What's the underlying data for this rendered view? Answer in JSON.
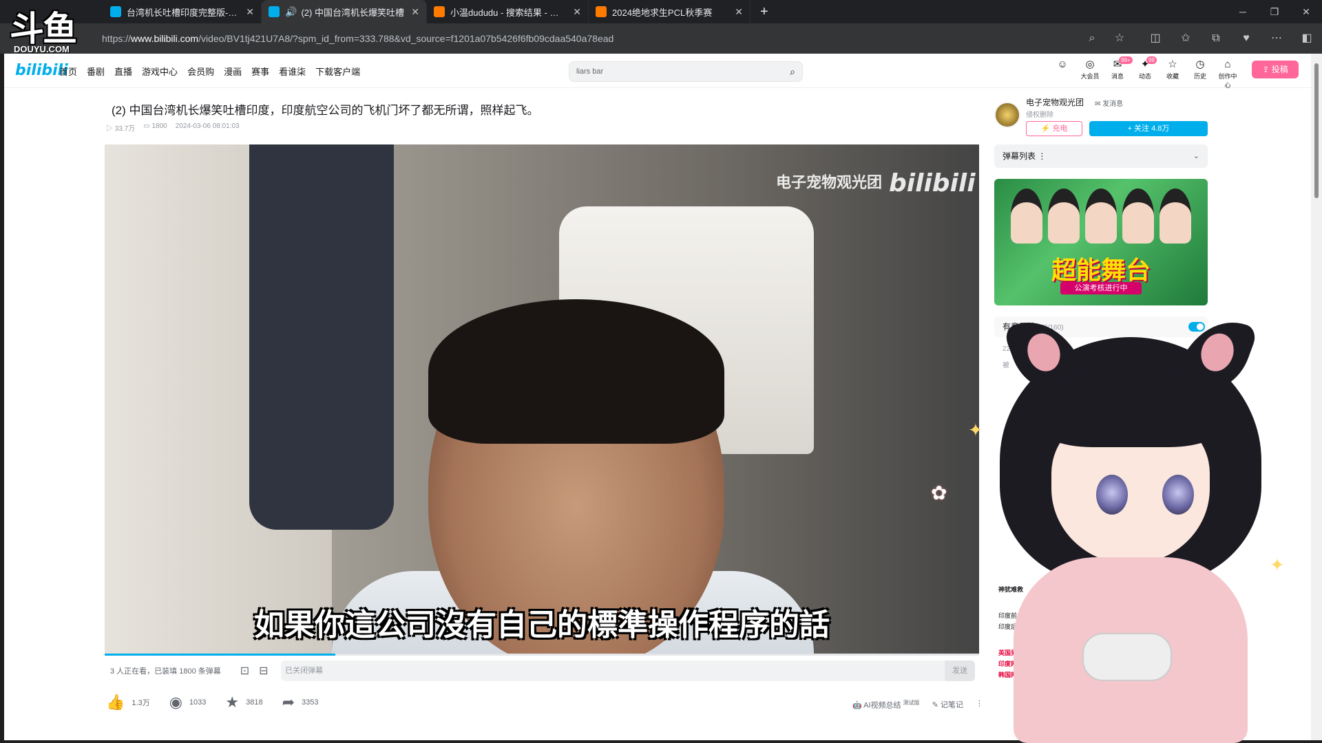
{
  "browser": {
    "tabs": [
      {
        "title": "台湾机长吐槽印度完整版-哔哩哔",
        "color": "#00aeec"
      },
      {
        "title": "(2) 中国台湾机长爆笑吐槽",
        "color": "#00aeec",
        "active": true
      },
      {
        "title": "小温dududu - 搜索结果 - 斗鱼直",
        "color": "#ff7a00"
      },
      {
        "title": "2024绝地求生PCL秋季赛",
        "color": "#ff7a00"
      }
    ],
    "new_tab": "+",
    "url_prefix": "https://",
    "url_host": "www.bilibili.com",
    "url_path": "/video/BV1tj421U7A8/?spm_id_from=333.788&vd_source=f1201a07b5426f6fb09cdaa540a78ead"
  },
  "overlay": {
    "logo": "斗鱼",
    "sub": "DOUYU.COM"
  },
  "header": {
    "logo": "bilibili",
    "nav": [
      "首页",
      "番剧",
      "直播",
      "游戏中心",
      "会员购",
      "漫画",
      "赛事",
      "看谁柒",
      "下载客户端"
    ],
    "search_value": "liars bar",
    "icons": [
      {
        "label": "",
        "badge": ""
      },
      {
        "label": "大会员",
        "badge": ""
      },
      {
        "label": "消息",
        "badge": "99+"
      },
      {
        "label": "动态",
        "badge": "99"
      },
      {
        "label": "收藏",
        "badge": ""
      },
      {
        "label": "历史",
        "badge": ""
      },
      {
        "label": "创作中心",
        "badge": ""
      }
    ],
    "upload": "投稿"
  },
  "video": {
    "title": "(2) 中国台湾机长爆笑吐槽印度，印度航空公司的飞机门坏了都无所谓，照样起飞。",
    "views": "33.7万",
    "danmaku_count": "1800",
    "date": "2024-03-06 08:01:03",
    "watermark": "电子宠物观光团",
    "watermark_logo": "bilibili",
    "subtitle": "如果你這公司沒有自己的標準操作程序的話",
    "progress": 0.264,
    "watching": "3 人正在看，已装填 1800 条弹幕",
    "danmaku_placeholder": "已关闭弹幕",
    "send": "发送",
    "likes": "1.3万",
    "coins": "1033",
    "favs": "3818",
    "shares": "3353",
    "ai_summary": "AI视频总结",
    "ai_tag": "测试版",
    "notes": "记笔记"
  },
  "sidebar": {
    "up_name": "电子宠物观光团",
    "up_msg": "发消息",
    "up_sub": "侵权删除",
    "charge": "充电",
    "follow": "+ 关注 4.8万",
    "danmaku_list": "弹幕列表",
    "ad_title": "超能舞台",
    "ad_sub": "公演考核进行中",
    "rec_head": "有意思的",
    "rec_count": "(56/160)",
    "rec_line": "2242.4万",
    "rec_line2": "被",
    "rec_items": [
      "神犹难救",
      "印度前，嘲笑印度",
      "印度后，疯狂的",
      "英国男子",
      "印度网",
      "韩国网"
    ]
  }
}
